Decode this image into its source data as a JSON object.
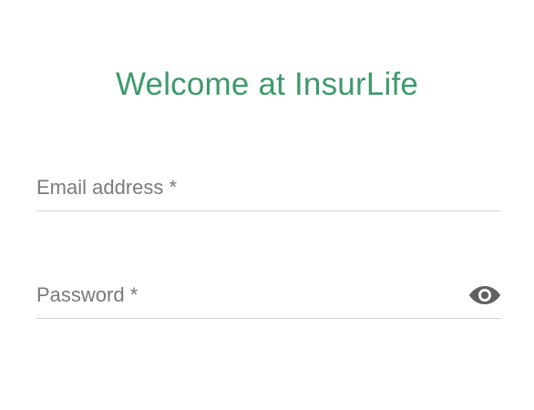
{
  "login": {
    "title": "Welcome at InsurLife",
    "email": {
      "label": "Email address *",
      "value": ""
    },
    "password": {
      "label": "Password *",
      "value": "",
      "toggle_icon": "eye-icon"
    }
  },
  "colors": {
    "title": "#3e9a6b",
    "label": "#7a7a7a",
    "underline": "#d3d3d3",
    "icon": "#616161"
  }
}
